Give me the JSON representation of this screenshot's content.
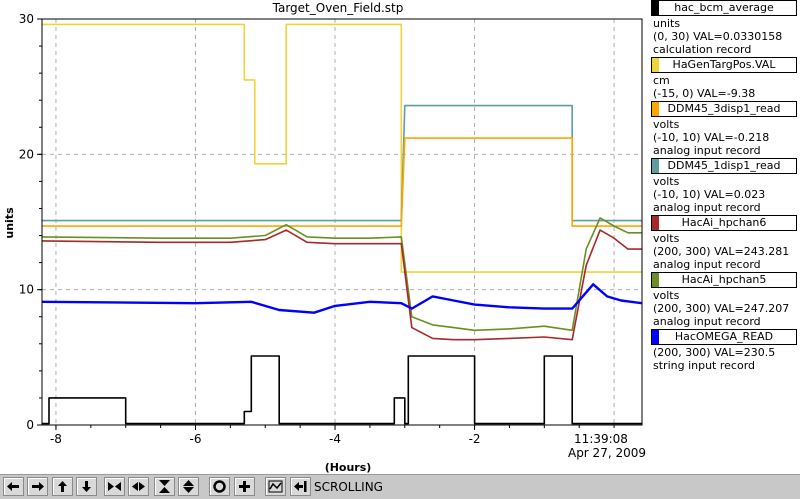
{
  "chart_data": {
    "type": "line",
    "title": "Target_Oven_Field.stp",
    "ylabel": "units",
    "xlabel": "(Hours)",
    "time_stamp": "11:39:08",
    "date_stamp": "Apr 27, 2009",
    "xlim": [
      -8.2,
      0.4
    ],
    "ylim": [
      0,
      30
    ],
    "x_ticks": [
      -8,
      -6,
      -4,
      -2
    ],
    "x_tick_labels": [
      "-8",
      "-6",
      "-4",
      "-2"
    ],
    "y_ticks": [
      0,
      10,
      20,
      30
    ],
    "y_tick_labels": [
      "0",
      "10",
      "20",
      "30"
    ],
    "grid": true,
    "series": [
      {
        "name": "HaGenTargPos.VAL",
        "color": "#f0d43a",
        "x": [
          -8.2,
          -5.3,
          -5.3,
          -5.15,
          -5.15,
          -4.7,
          -4.7,
          -3.05,
          -3.05,
          0.4
        ],
        "y": [
          29.6,
          29.6,
          25.5,
          25.5,
          19.3,
          19.3,
          29.6,
          29.6,
          11.3,
          11.3
        ]
      },
      {
        "name": "DDM45_1disp1_read",
        "color": "#5f9ea0",
        "x": [
          -8.2,
          -3.05,
          -3.0,
          -0.6,
          -0.6,
          0.4
        ],
        "y": [
          15.1,
          15.1,
          23.6,
          23.6,
          15.1,
          15.1
        ]
      },
      {
        "name": "DDM45_3disp1_read",
        "color": "#ffa500",
        "x": [
          -8.2,
          -3.05,
          -3.0,
          -0.6,
          -0.6,
          0.4
        ],
        "y": [
          14.7,
          14.7,
          21.2,
          21.2,
          14.7,
          14.7
        ]
      },
      {
        "name": "HacAi_hpchan5",
        "color": "#6b8e23",
        "x": [
          -8.2,
          -6.5,
          -5.5,
          -5.0,
          -4.7,
          -4.4,
          -4.0,
          -3.5,
          -3.05,
          -2.9,
          -2.6,
          -2.3,
          -2.0,
          -1.5,
          -1.0,
          -0.6,
          -0.4,
          -0.2,
          0.0,
          0.2,
          0.4
        ],
        "y": [
          13.9,
          13.8,
          13.8,
          14.0,
          14.8,
          13.9,
          13.8,
          13.8,
          13.9,
          8.0,
          7.4,
          7.2,
          7.0,
          7.1,
          7.3,
          7.0,
          13.0,
          15.3,
          14.7,
          14.2,
          14.2
        ]
      },
      {
        "name": "HacAi_hpchan6",
        "color": "#a52a2a",
        "x": [
          -8.2,
          -6.5,
          -5.5,
          -5.0,
          -4.7,
          -4.4,
          -4.0,
          -3.5,
          -3.05,
          -2.9,
          -2.6,
          -2.3,
          -2.0,
          -1.5,
          -1.0,
          -0.6,
          -0.4,
          -0.2,
          0.0,
          0.2,
          0.4
        ],
        "y": [
          13.6,
          13.5,
          13.5,
          13.7,
          14.4,
          13.5,
          13.4,
          13.4,
          13.4,
          7.2,
          6.4,
          6.3,
          6.3,
          6.4,
          6.5,
          6.3,
          11.8,
          14.4,
          13.8,
          13.0,
          13.0
        ]
      },
      {
        "name": "HacOMEGA_READ",
        "color": "#0000ff",
        "x": [
          -8.2,
          -6.0,
          -5.2,
          -4.8,
          -4.3,
          -4.0,
          -3.5,
          -3.05,
          -2.9,
          -2.6,
          -2.3,
          -2.0,
          -1.5,
          -1.0,
          -0.6,
          -0.3,
          -0.1,
          0.1,
          0.4
        ],
        "y": [
          9.1,
          9.0,
          9.1,
          8.5,
          8.3,
          8.8,
          9.1,
          9.0,
          8.6,
          9.5,
          9.2,
          8.9,
          8.7,
          8.6,
          8.6,
          10.4,
          9.5,
          9.2,
          9.0
        ]
      },
      {
        "name": "hac_bcm_average",
        "color": "#000000",
        "x": [
          -8.2,
          -8.1,
          -8.1,
          -7.0,
          -7.0,
          -5.3,
          -5.3,
          -5.2,
          -5.2,
          -4.8,
          -4.8,
          -3.15,
          -3.15,
          -3.0,
          -3.0,
          -2.95,
          -2.95,
          -2.0,
          -2.0,
          -1.0,
          -1.0,
          -0.6,
          -0.6,
          0.4
        ],
        "y": [
          0.1,
          0.1,
          2.0,
          2.0,
          0.1,
          0.1,
          1.0,
          1.0,
          5.1,
          5.1,
          0.1,
          0.1,
          2.0,
          2.0,
          0.1,
          0.1,
          5.1,
          5.1,
          0.1,
          0.1,
          5.1,
          5.1,
          0.1,
          0.1
        ]
      }
    ]
  },
  "legend": [
    {
      "name": "hac_bcm_average",
      "color": "#000000",
      "lines": [
        "units",
        "(0, 30) VAL=0.0330158",
        "calculation record"
      ]
    },
    {
      "name": "HaGenTargPos.VAL",
      "color": "#f0d43a",
      "lines": [
        "cm",
        "(-15, 0) VAL=-9.38"
      ]
    },
    {
      "name": "DDM45_3disp1_read",
      "color": "#ffa500",
      "lines": [
        "volts",
        "(-10, 10) VAL=-0.218",
        "analog input record"
      ]
    },
    {
      "name": "DDM45_1disp1_read",
      "color": "#5f9ea0",
      "lines": [
        "volts",
        "(-10, 10) VAL=0.023",
        "analog input record"
      ]
    },
    {
      "name": "HacAi_hpchan6",
      "color": "#a52a2a",
      "lines": [
        "volts",
        "(200, 300) VAL=243.281",
        "analog input record"
      ]
    },
    {
      "name": "HacAi_hpchan5",
      "color": "#6b8e23",
      "lines": [
        "volts",
        "(200, 300) VAL=247.207",
        "analog input record"
      ]
    },
    {
      "name": "HacOMEGA_READ",
      "color": "#0000ff",
      "lines": [
        "(200, 300) VAL=230.5",
        "string input record"
      ]
    }
  ],
  "toolbar": {
    "buttons": [
      {
        "name": "scroll-left-icon"
      },
      {
        "name": "scroll-right-icon"
      },
      {
        "name": "scroll-up-icon"
      },
      {
        "name": "scroll-down-icon"
      },
      {
        "name": "compress-horizontal-icon"
      },
      {
        "name": "expand-horizontal-icon"
      },
      {
        "name": "compress-vertical-icon"
      },
      {
        "name": "expand-vertical-icon"
      },
      {
        "name": "circle-icon"
      },
      {
        "name": "crosshair-icon"
      },
      {
        "name": "graph-icon"
      },
      {
        "name": "back-to-start-icon"
      }
    ],
    "mode_label": "SCROLLING"
  }
}
